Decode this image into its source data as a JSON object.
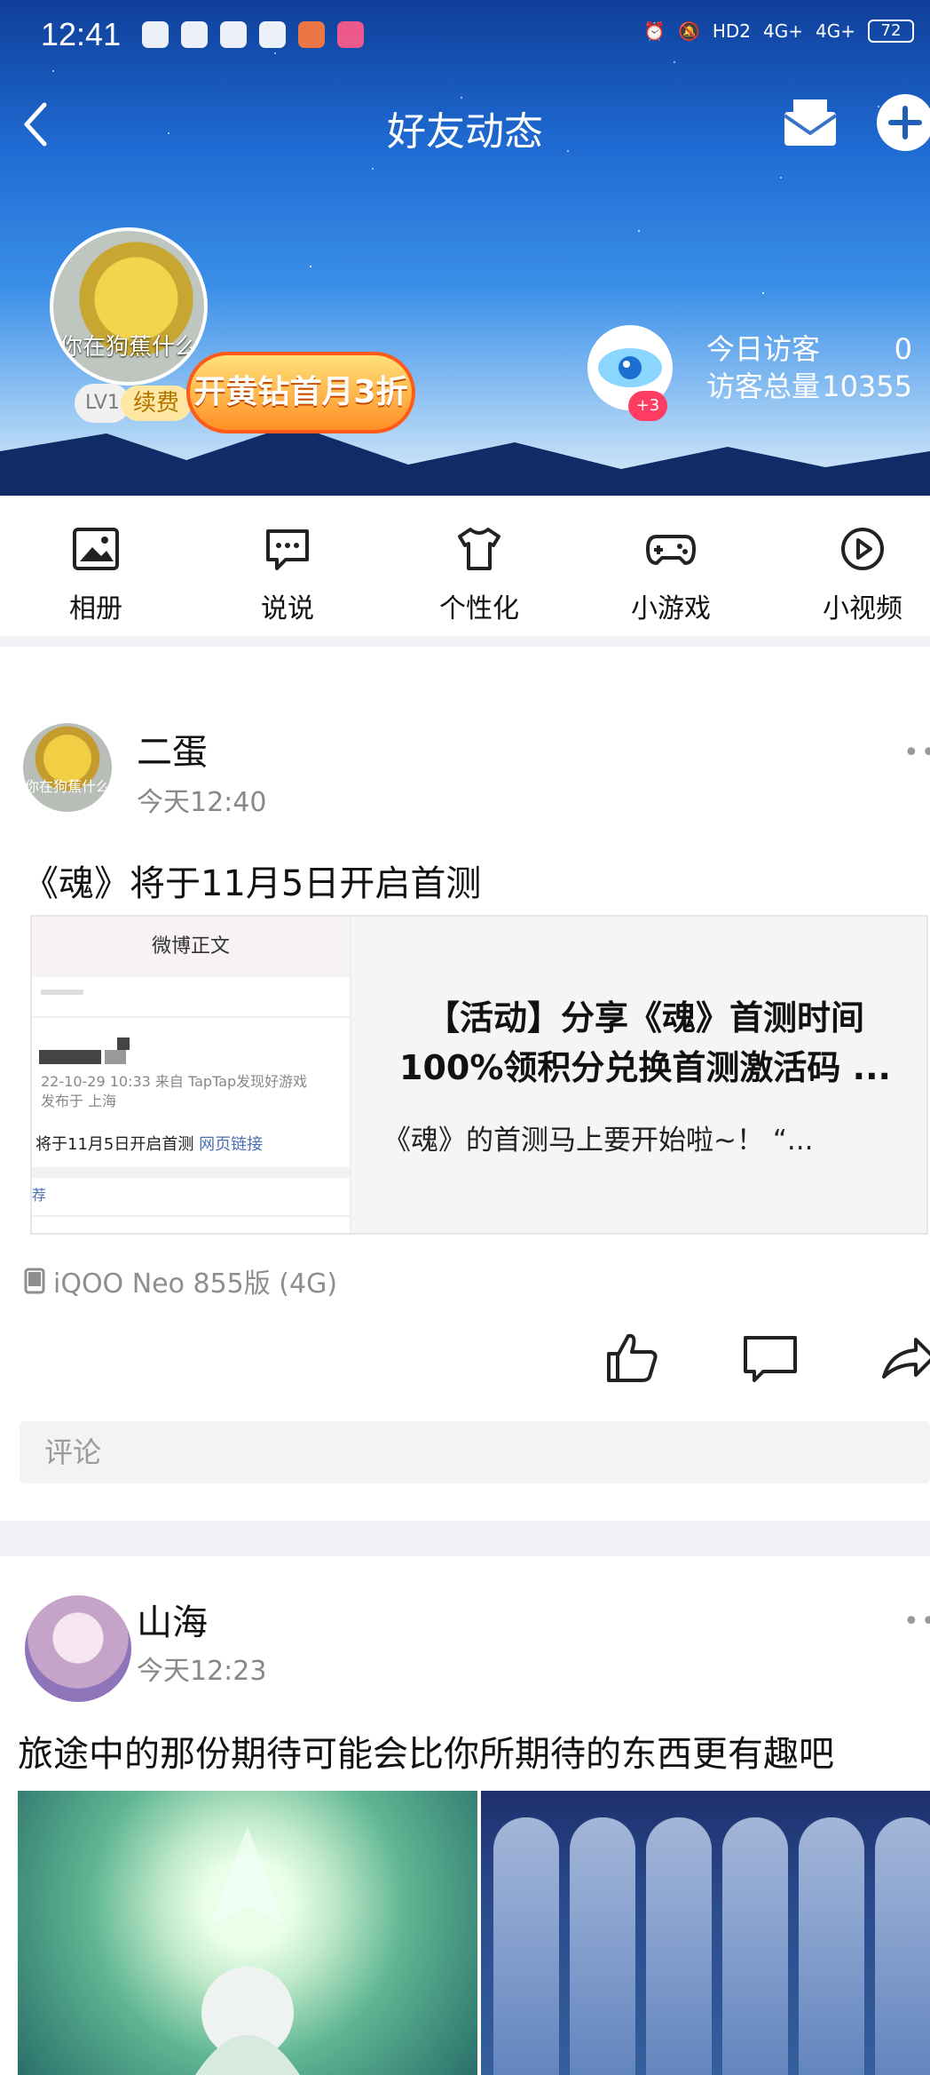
{
  "status": {
    "time": "12:41",
    "battery": "72",
    "network": [
      "HD2",
      "4G+",
      "4G+"
    ]
  },
  "header": {
    "title": "好友动态",
    "avatar_caption": "你在狗蕉什么",
    "level": "LV1",
    "renew": "续费",
    "promo": "开黄钻首月3折",
    "visitor_badge": "+3",
    "today_visitors_label": "今日访客",
    "today_visitors_value": "0",
    "total_visitors_label": "访客总量",
    "total_visitors_value": "10355"
  },
  "tabs": [
    {
      "label": "相册",
      "icon": "photo-album-icon",
      "dot": true
    },
    {
      "label": "说说",
      "icon": "chat-icon",
      "dot": false
    },
    {
      "label": "个性化",
      "icon": "tshirt-icon",
      "dot": true
    },
    {
      "label": "小游戏",
      "icon": "gamepad-icon",
      "dot": true
    },
    {
      "label": "小视频",
      "icon": "play-icon",
      "dot": false
    }
  ],
  "post1": {
    "name": "二蛋",
    "time": "今天12:40",
    "text": "《魂》将于11月5日开启首测",
    "avatar_caption": "你在狗蕉什么",
    "card": {
      "thumb_header": "微博正文",
      "thumb_meta": "22-10-29 10:33  来自 TapTap发现好游戏",
      "thumb_loc": "发布于 上海",
      "thumb_text": "将于11月5日开启首测",
      "thumb_link": "网页链接",
      "thumb_rec": "荐",
      "title_line1": "【活动】分享《魂》首测时间",
      "title_line2": "100%领积分兑换首测激活码 ...",
      "desc": "《魂》的首测马上要开始啦~！ “..."
    },
    "device": "iQOO Neo 855版 (4G)",
    "comment_placeholder": "评论"
  },
  "post2": {
    "name": "山海",
    "time": "今天12:23",
    "text": "旅途中的那份期待可能会比你所期待的东西更有趣吧"
  },
  "colors": {
    "accent_red": "#ff4a32",
    "promo_orange": "#ff8f24"
  }
}
